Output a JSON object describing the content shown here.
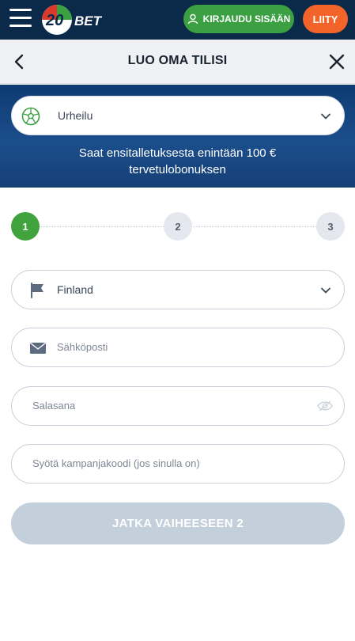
{
  "header": {
    "logo_text": "20BET",
    "login_label": "KIRJAUDU SISÄÄN",
    "join_label": "LIITY"
  },
  "titlebar": {
    "title": "LUO OMA TILISI"
  },
  "banner": {
    "sport_select_value": "Urheilu",
    "promo_line1": "Saat ensitalletuksesta enintään 100 €",
    "promo_line2": "tervetulobonuksen"
  },
  "stepper": {
    "steps": [
      "1",
      "2",
      "3"
    ],
    "current": 1
  },
  "form": {
    "country_value": "Finland",
    "email_placeholder": "Sähköposti",
    "password_placeholder": "Salasana",
    "promo_code_placeholder": "Syötä kampanjakoodi  (jos sinulla on)",
    "submit_label": "JATKA VAIHEESEEN 2"
  },
  "colors": {
    "topbar": "#0b2a4a",
    "login_button": "#3aa042",
    "join_button": "#f2642a",
    "banner": "#1b4e8c",
    "active_step": "#41a33e",
    "submit_disabled": "#c3cfdb"
  },
  "icons": {
    "menu": "hamburger-icon",
    "user": "user-icon",
    "back": "chevron-left-icon",
    "close": "close-icon",
    "sport": "soccer-ball-icon",
    "country": "flag-icon",
    "email": "envelope-icon",
    "password_toggle": "eye-icon"
  }
}
